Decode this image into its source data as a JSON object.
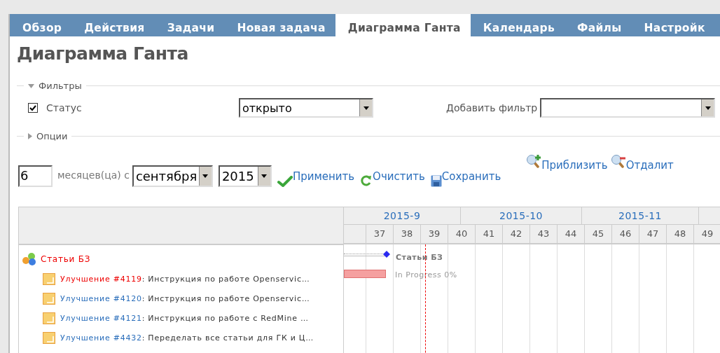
{
  "tabs": [
    {
      "label": "Обзор",
      "selected": false
    },
    {
      "label": "Действия",
      "selected": false
    },
    {
      "label": "Задачи",
      "selected": false
    },
    {
      "label": "Новая задача",
      "selected": false
    },
    {
      "label": "Диаграмма Ганта",
      "selected": true
    },
    {
      "label": "Календарь",
      "selected": false
    },
    {
      "label": "Файлы",
      "selected": false
    },
    {
      "label": "Настройк",
      "selected": false
    }
  ],
  "page_title": "Диаграмма Ганта",
  "filters": {
    "legend": "Фильтры",
    "expanded": true,
    "rows": [
      {
        "label": "Статус",
        "checked": true,
        "value": "открыто"
      }
    ],
    "add_filter": {
      "label": "Добавить фильтр"
    }
  },
  "options": {
    "legend": "Опции",
    "expanded": false
  },
  "period": {
    "months": "6",
    "months_label": "месяцев(ца) с",
    "month": "сентября",
    "year": "2015"
  },
  "actions": [
    {
      "label": "Применить",
      "kind": "apply"
    },
    {
      "label": "Очистить",
      "kind": "clear"
    },
    {
      "label": "Сохранить",
      "kind": "save"
    }
  ],
  "zoom": [
    {
      "label": "Приблизить",
      "kind": "zoom-in"
    },
    {
      "label": "Отдалит",
      "kind": "zoom-out"
    }
  ],
  "gantt": {
    "months": [
      "2015-9",
      "2015-10",
      "2015-11"
    ],
    "weeks": [
      "37",
      "38",
      "39",
      "40",
      "41",
      "42",
      "43",
      "44",
      "45",
      "46",
      "47",
      "48",
      "49"
    ],
    "project": {
      "name": "Статьи БЗ",
      "bar_label": "Статьи БЗ"
    },
    "issues": [
      {
        "link": "Улучшение #4119",
        "subject": ": Инструкция по работе Openservic…",
        "overdue": true,
        "bar_label": "In Progress 0%"
      },
      {
        "link": "Улучшение #4120",
        "subject": ": Инструкция по работе Openservic…",
        "overdue": false
      },
      {
        "link": "Улучшение #4121",
        "subject": ": Инструкция по работе с RedMine …",
        "overdue": false
      },
      {
        "link": "Улучшение #4432",
        "subject": ": Переделать все статьи для ГК и Ц…",
        "overdue": false
      }
    ]
  }
}
